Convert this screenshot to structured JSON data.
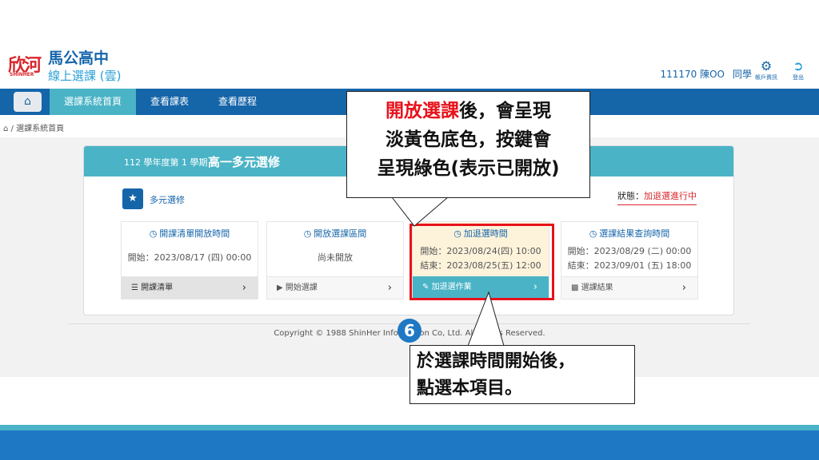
{
  "header": {
    "logo_main": "欣河",
    "logo_sub": "SHINHER",
    "school_name": "馬公高中",
    "subtitle": "線上選課 (雲)",
    "user_id_name": "111170 陳OO",
    "user_role": "同學",
    "account_label": "帳戶資訊",
    "logout_label": "登出",
    "account_icon": "user-gear-icon",
    "logout_icon": "logout-icon"
  },
  "nav": {
    "home_icon": "home-icon",
    "items": [
      {
        "label": "選課系統首頁",
        "active": true
      },
      {
        "label": "查看課表",
        "active": false
      },
      {
        "label": "查看歷程",
        "active": false
      }
    ]
  },
  "breadcrumb": {
    "separator": "/",
    "current": "選課系統首頁"
  },
  "panel": {
    "term": "112 學年度第 1 學期",
    "title": "高一多元選修",
    "section_title": "多元選修",
    "status_label": "狀態：",
    "status_value": "加退選進行中",
    "cards": [
      {
        "title": "開課清單開放時間",
        "line1": "開始：2023/08/17 (四) 00:00",
        "line2": "",
        "footer": "開課清單",
        "footer_icon": "list-icon"
      },
      {
        "title": "開放選課區間",
        "line1": "尚未開放",
        "line2": "",
        "footer": "開始選課",
        "footer_icon": "play-circle-icon"
      },
      {
        "title": "加退選時間",
        "line1": "開始：2023/08/24(四) 10:00",
        "line2": "結束：2023/08/25(五) 12:00",
        "footer": "加退選作業",
        "footer_icon": "edit-icon"
      },
      {
        "title": "選課結果查詢時間",
        "line1": "開始：2023/08/29 (二) 00:00",
        "line2": "結束：2023/09/01 (五) 18:00",
        "footer": "選課結果",
        "footer_icon": "bar-chart-icon"
      }
    ]
  },
  "footer": {
    "copyright": "Copyright © 1988 ShinHer Information Co, Ltd. All Rights Reserved."
  },
  "annotations": {
    "top_red": "開放選課",
    "top_rest1": "後，會呈現",
    "top_line2": "淡黃色底色，按鍵會",
    "top_line3": "呈現綠色(表示已開放)",
    "step": "6",
    "bottom_line1": "於選課時間開始後，",
    "bottom_line2": "點選本項目。"
  },
  "colors": {
    "nav": "#1565a9",
    "accent": "#4ab3c6",
    "highlight_bg": "#fdf3db",
    "annotation_red": "#e8121b"
  }
}
